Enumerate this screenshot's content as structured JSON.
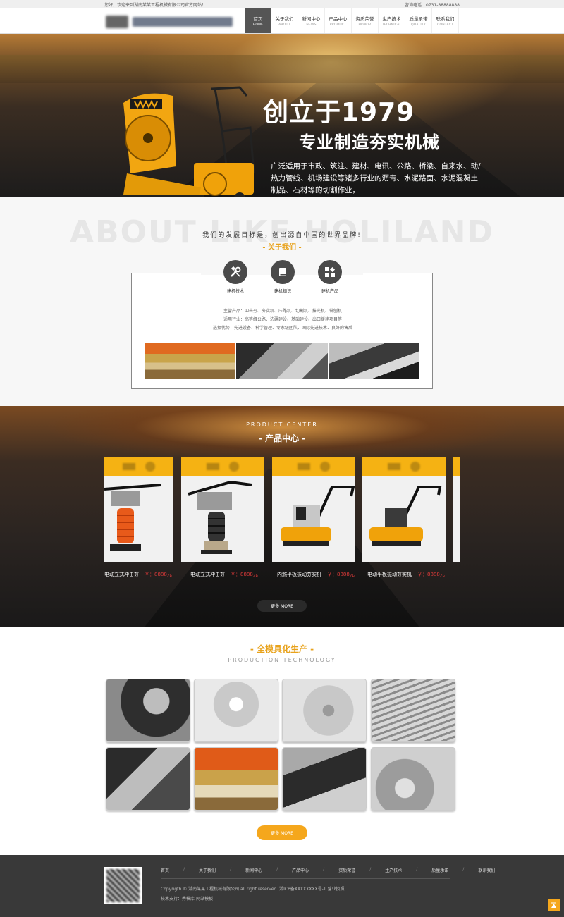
{
  "topbar": {
    "welcome": "您好，欢迎来到湖南某某工程机械有限公司官方网站！",
    "phone": "咨询电话：0731-88888888"
  },
  "nav": [
    {
      "zh": "首页",
      "en": "HOME"
    },
    {
      "zh": "关于我们",
      "en": "ABOUT"
    },
    {
      "zh": "新闻中心",
      "en": "NEWS"
    },
    {
      "zh": "产品中心",
      "en": "PRODUCT"
    },
    {
      "zh": "资质荣誉",
      "en": "HONOR"
    },
    {
      "zh": "生产技术",
      "en": "TECHNICAL"
    },
    {
      "zh": "质量承诺",
      "en": "QUALITY"
    },
    {
      "zh": "联系我们",
      "en": "CONTACT"
    }
  ],
  "hero": {
    "title1": "创立于1979",
    "title2": "专业制造夯实机械",
    "desc": "广泛适用于市政、筑注、建材、电讯、公路、桥梁、自来水、动/热力管线、机场建设等诸多行业的沥青、水泥路面、水泥混凝土制品、石材等的切割作业，"
  },
  "about": {
    "bigtext": "ABOUT LIKE HOLILAND",
    "slogan": "我们的发展目标是，创出源自中国的世界品牌!",
    "title": "- 关于我们 -",
    "icons": [
      {
        "label": "建机技术",
        "icon": "wrench-screwdriver-icon"
      },
      {
        "label": "建机知识",
        "icon": "book-icon"
      },
      {
        "label": "建机产品",
        "icon": "grid-icon"
      }
    ],
    "lines": [
      "主营产品：冲击夯、夯实机、压路机、切割机、抹光机、铣刨机",
      "适用行业：高等级公路、边疆建设、基础建设、出口援建项目等",
      "选择优势：先进设备、科学管理、专家级团队、国际先进技术、良好的售后"
    ]
  },
  "products": {
    "en": "PRODUCT CENTER",
    "zh": "- 产品中心 -",
    "items": [
      {
        "name": "电动立式冲击夯",
        "price": "￥：8888元"
      },
      {
        "name": "电动立式冲击夯",
        "price": "￥：8888元"
      },
      {
        "name": "内燃平板振动夯实机",
        "price": "￥：8888元"
      },
      {
        "name": "电动平板振动夯实机",
        "price": "￥：8888元"
      }
    ],
    "more": "更多 MORE"
  },
  "production": {
    "zh": "- 全模具化生产 -",
    "en": "PRODUCTION TECHNOLOGY",
    "more": "更多 MORE"
  },
  "footer": {
    "nav": [
      "首页",
      "关于我们",
      "新闻中心",
      "产品中心",
      "资质荣誉",
      "生产技术",
      "质量承诺",
      "联系我们"
    ],
    "copyright": "Copyrigth © 湖南某某工程机械有限公司 all right reserved. 湘ICP备XXXXXXXX号-1 营业执照",
    "tech": "技术支持：秀模库-网站模板"
  },
  "colors": {
    "accent": "#f5a71c",
    "title": "#e8a21b",
    "price": "#e23b3b",
    "footer": "#393939"
  }
}
